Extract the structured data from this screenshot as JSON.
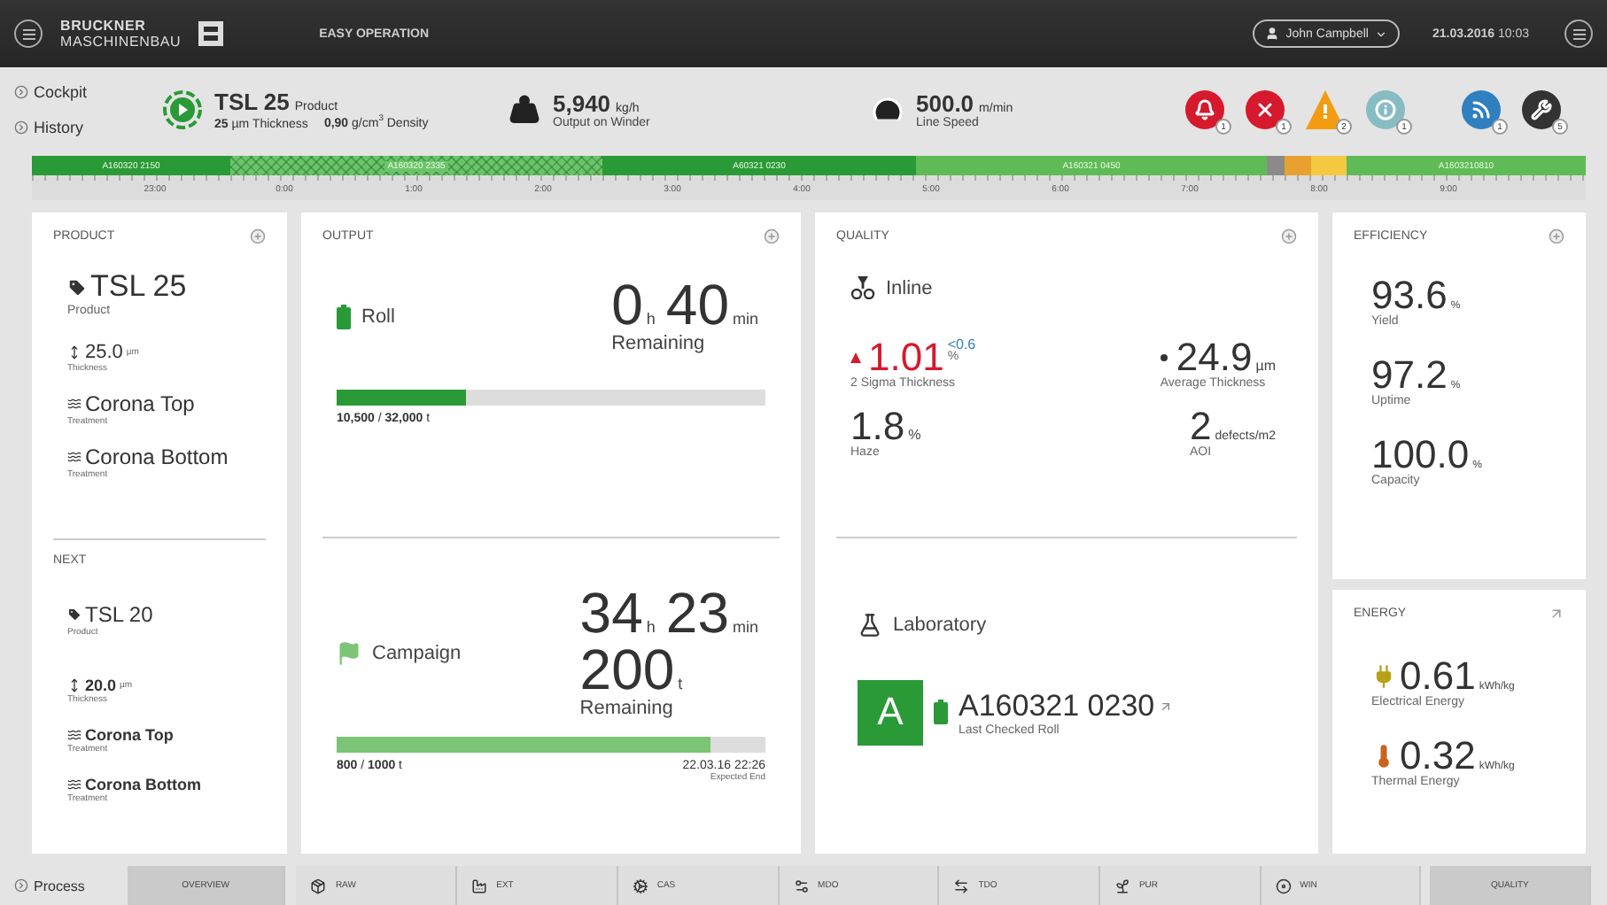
{
  "top_bar": {
    "brand_line1": "BRUCKNER",
    "brand_line2": "MASCHINENBAU",
    "app_title": "EASY OPERATION",
    "user": "John Campbell",
    "date": "21.03.2016",
    "time": "10:03"
  },
  "nav_links": [
    "Cockpit",
    "History"
  ],
  "status": {
    "product": {
      "name": "TSL 25",
      "label": "Product",
      "details": [
        "**25** µm Thickness",
        "**0,90** g/cm$^{3}$ Density"
      ]
    },
    "output": {
      "value": "5,940",
      "unit": "kg/h",
      "label": "Output on Winder"
    },
    "speed": {
      "value": "500.0",
      "unit": "m/min",
      "label": "Line Speed"
    }
  },
  "alerts": [
    {
      "count": "1",
      "color": "#d7192d"
    },
    {
      "count": "1",
      "color": "#d7192d"
    },
    {
      "count": "2",
      "color": "#f39c12"
    },
    {
      "count": "1",
      "color": "#86bcc2"
    },
    {
      "count": "1",
      "color": "#2f7fc1"
    },
    {
      "count": "5",
      "color": "#333333"
    }
  ],
  "timeline": {
    "segments": [
      {
        "kind": "roll",
        "label": "A160320 2150",
        "color": "#2a9a37"
      },
      {
        "kind": "scrap",
        "label": "A160320 2335",
        "color": "#6cc46a"
      },
      {
        "kind": "roll",
        "label": "A60321 0230",
        "color": "#2a9a37"
      },
      {
        "kind": "roll",
        "label": "A160321 0450",
        "color": "#5fbb55"
      },
      {
        "kind": "stop",
        "color": "#8a8a8a"
      },
      {
        "kind": "stop",
        "color": "#e8a030"
      },
      {
        "kind": "stop",
        "color": "#f5c842"
      },
      {
        "kind": "roll",
        "label": "A1603210810",
        "color": "#5fbb55"
      }
    ],
    "ticks": [
      "23:00",
      "0:00",
      "1:00",
      "2:00",
      "3:00",
      "4:00",
      "5:00",
      "6:00",
      "7:00",
      "8:00",
      "9:00"
    ]
  },
  "product": {
    "title": "PRODUCT",
    "current": {
      "name": "TSL 25",
      "name_label": "Product",
      "thickness": "25.0",
      "thickness_unit": "µm",
      "thickness_label": "Thickness",
      "treatments": [
        {
          "name": "Corona Top",
          "label": "Treatment"
        },
        {
          "name": "Corona Bottom",
          "label": "Treatment"
        }
      ]
    },
    "next_title": "NEXT",
    "next": {
      "name": "TSL 20",
      "name_label": "Product",
      "thickness": "20.0",
      "thickness_unit": "µm",
      "thickness_label": "Thickness",
      "treatments": [
        {
          "name": "Corona Top",
          "label": "Treatment"
        },
        {
          "name": "Corona Bottom",
          "label": "Treatment"
        }
      ]
    }
  },
  "output": {
    "title": "OUTPUT",
    "roll": {
      "name": "Roll",
      "hours": "0",
      "hours_unit": "h",
      "minutes": "40",
      "minutes_unit": "min",
      "remaining": "Remaining",
      "level": 0.3,
      "progress": "**10,500** / **32,000** t"
    },
    "campaign": {
      "name": "Campaign",
      "hours": "34",
      "hours_unit": "h",
      "minutes": "23",
      "minutes_unit": "min",
      "tons": "200",
      "tons_unit": "t",
      "remaining": "Remaining",
      "level": 0.87,
      "progress": "**800** / **1000** t",
      "end": "22.03.16 22:26",
      "end_label": "Expected End"
    }
  },
  "quality": {
    "title": "QUALITY",
    "inline": {
      "name": "Inline",
      "metrics": [
        {
          "value": "1.01",
          "unit": "%",
          "limit": "<0.6",
          "label": "2 Sigma Thickness",
          "rising": true,
          "steady": false,
          "alarm": true
        },
        {
          "value": "24.9",
          "unit": "µm",
          "label": "Average Thickness",
          "rising": false,
          "steady": true,
          "alarm": false
        },
        {
          "value": "1.8",
          "unit": "%",
          "label": "Haze",
          "rising": false,
          "steady": false,
          "alarm": false
        },
        {
          "value": "2",
          "unit": "defects/m2",
          "label": "AOI",
          "rising": false,
          "steady": false,
          "alarm": false
        }
      ]
    },
    "laboratory": {
      "name": "Laboratory",
      "grade": "A",
      "roll": "A160321 0230",
      "label": "Last Checked Roll"
    }
  },
  "efficiency": {
    "title": "EFFICIENCY",
    "metrics": [
      {
        "value": "93.6",
        "unit": "%",
        "label": "Yield"
      },
      {
        "value": "97.2",
        "unit": "%",
        "label": "Uptime"
      },
      {
        "value": "100.0",
        "unit": "%",
        "label": "Capacity"
      }
    ]
  },
  "energy": {
    "title": "ENERGY",
    "metrics": [
      {
        "value": "0.61",
        "unit": "kWh/kg",
        "label": "Electrical Energy"
      },
      {
        "value": "0.32",
        "unit": "kWh/kg",
        "label": "Thermal Energy"
      }
    ]
  },
  "bottom_nav": {
    "process": "Process",
    "overview": "OVERVIEW",
    "stages": [
      "RAW",
      "EXT",
      "CAS",
      "MDO",
      "TDO",
      "PUR",
      "WIN"
    ],
    "quality": "QUALITY"
  }
}
